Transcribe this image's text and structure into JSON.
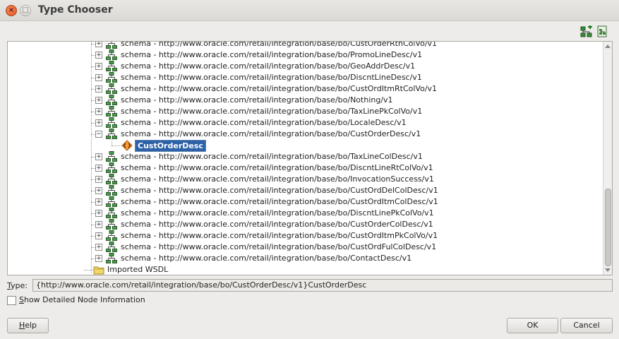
{
  "window": {
    "title": "Type Chooser"
  },
  "toolbar": {
    "icons": [
      "add-schema-icon",
      "import-schema-icon"
    ]
  },
  "tree": {
    "rows": [
      {
        "label": "schema - http://www.oracle.com/retail/integration/base/bo/CustOrderRtnColVo/v1",
        "expanded": false
      },
      {
        "label": "schema - http://www.oracle.com/retail/integration/base/bo/PromoLineDesc/v1",
        "expanded": false
      },
      {
        "label": "schema - http://www.oracle.com/retail/integration/base/bo/GeoAddrDesc/v1",
        "expanded": false
      },
      {
        "label": "schema - http://www.oracle.com/retail/integration/base/bo/DiscntLineDesc/v1",
        "expanded": false
      },
      {
        "label": "schema - http://www.oracle.com/retail/integration/base/bo/CustOrdItmRtColVo/v1",
        "expanded": false
      },
      {
        "label": "schema - http://www.oracle.com/retail/integration/base/bo/Nothing/v1",
        "expanded": false
      },
      {
        "label": "schema - http://www.oracle.com/retail/integration/base/bo/TaxLinePkColVo/v1",
        "expanded": false
      },
      {
        "label": "schema - http://www.oracle.com/retail/integration/base/bo/LocaleDesc/v1",
        "expanded": false
      },
      {
        "label": "schema - http://www.oracle.com/retail/integration/base/bo/CustOrderDesc/v1",
        "expanded": true
      },
      {
        "label": "CustOrderDesc",
        "child": true,
        "selected": true
      },
      {
        "label": "schema - http://www.oracle.com/retail/integration/base/bo/TaxLineColDesc/v1",
        "expanded": false
      },
      {
        "label": "schema - http://www.oracle.com/retail/integration/base/bo/DiscntLineRtColVo/v1",
        "expanded": false
      },
      {
        "label": "schema - http://www.oracle.com/retail/integration/base/bo/InvocationSuccess/v1",
        "expanded": false
      },
      {
        "label": "schema - http://www.oracle.com/retail/integration/base/bo/CustOrdDelColDesc/v1",
        "expanded": false
      },
      {
        "label": "schema - http://www.oracle.com/retail/integration/base/bo/CustOrdItmColDesc/v1",
        "expanded": false
      },
      {
        "label": "schema - http://www.oracle.com/retail/integration/base/bo/DiscntLinePkColVo/v1",
        "expanded": false
      },
      {
        "label": "schema - http://www.oracle.com/retail/integration/base/bo/CustOrderColDesc/v1",
        "expanded": false
      },
      {
        "label": "schema - http://www.oracle.com/retail/integration/base/bo/CustOrdItmPkColVo/v1",
        "expanded": false
      },
      {
        "label": "schema - http://www.oracle.com/retail/integration/base/bo/CustOrdFulColDesc/v1",
        "expanded": false
      },
      {
        "label": "schema - http://www.oracle.com/retail/integration/base/bo/ContactDesc/v1",
        "expanded": false
      }
    ],
    "imported_wsdl": "Imported WSDL"
  },
  "type": {
    "label_first": "T",
    "label_rest": "ype:",
    "value": "{http://www.oracle.com/retail/integration/base/bo/CustOrderDesc/v1}CustOrderDesc"
  },
  "show_detailed": {
    "label_first": "S",
    "label_rest": "how Detailed Node Information",
    "checked": false
  },
  "buttons": {
    "help_first": "H",
    "help_rest": "elp",
    "ok": "OK",
    "cancel": "Cancel"
  },
  "colors": {
    "selection": "#2d61a8",
    "close_button": "#e0531f"
  }
}
